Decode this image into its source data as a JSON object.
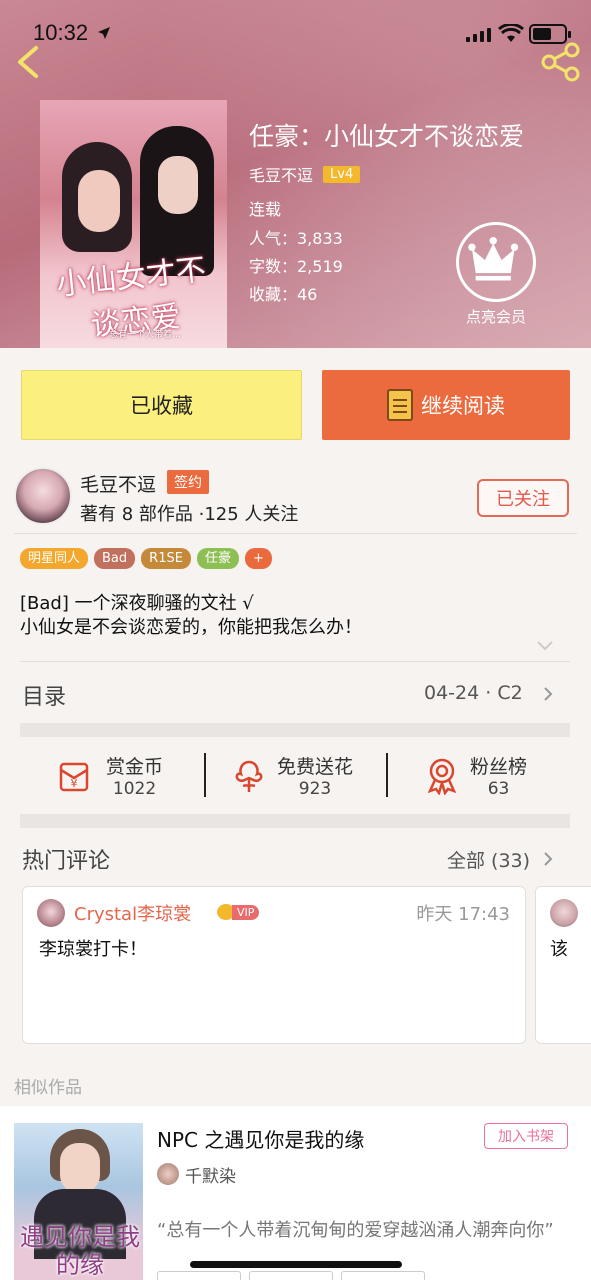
{
  "status_bar": {
    "time": "10:32"
  },
  "book": {
    "title": "任豪：小仙女才不谈恋爱",
    "author": "毛豆不逗",
    "level": "Lv4",
    "status": "连载",
    "popularity": "人气：3,833",
    "word_count": "字数：2,519",
    "favorites": "收藏：46",
    "member_label": "点亮会员"
  },
  "cover": {
    "title_text": "小仙女才不谈恋爱",
    "subtitle_text": "总有一个人带着…"
  },
  "actions": {
    "collected_label": "已收藏",
    "read_label": "继续阅读"
  },
  "author_block": {
    "name": "毛豆不逗",
    "sign_badge": "签约",
    "stats": "著有 8 部作品 ·125 人关注",
    "follow_label": "已关注"
  },
  "tags": [
    {
      "label": "明星同人",
      "color": "#f3a72d"
    },
    {
      "label": "Bad",
      "color": "#c1705d"
    },
    {
      "label": "R1SE",
      "color": "#c48a3a"
    },
    {
      "label": "任豪",
      "color": "#8ebf55"
    },
    {
      "label": "+",
      "color": "#ea6a3e"
    }
  ],
  "description": {
    "line1": "[Bad] 一个深夜聊骚的文社 √",
    "line2": "小仙女是不会谈恋爱的，你能把我怎么办！"
  },
  "toc": {
    "label": "目录",
    "latest": "04-24 · C2"
  },
  "stats": [
    {
      "title": "赏金币",
      "value": "1022",
      "icon": "coin-envelope-icon"
    },
    {
      "title": "免费送花",
      "value": "923",
      "icon": "flower-icon"
    },
    {
      "title": "粉丝榜",
      "value": "63",
      "icon": "medal-icon"
    }
  ],
  "hot_comments": {
    "label": "热门评论",
    "all": "全部 (33)",
    "items": [
      {
        "user": "Crystal李琼裳",
        "vip": "VIP",
        "time": "昨天 17:43",
        "text": "李琼裳打卡！"
      },
      {
        "text": "该"
      }
    ]
  },
  "similar": {
    "label": "相似作品",
    "item": {
      "title": "NPC 之遇见你是我的缘",
      "author": "千默染",
      "add_label": "加入书架",
      "desc": "“总有一个人带着沉甸甸的爱穿越汹涌人潮奔向你”",
      "cover_text": "遇见你是我的缘"
    }
  },
  "colors": {
    "accent_orange": "#eb6a3e",
    "collected_yellow": "#fbf07e",
    "vip_pink": "#e9729b"
  }
}
